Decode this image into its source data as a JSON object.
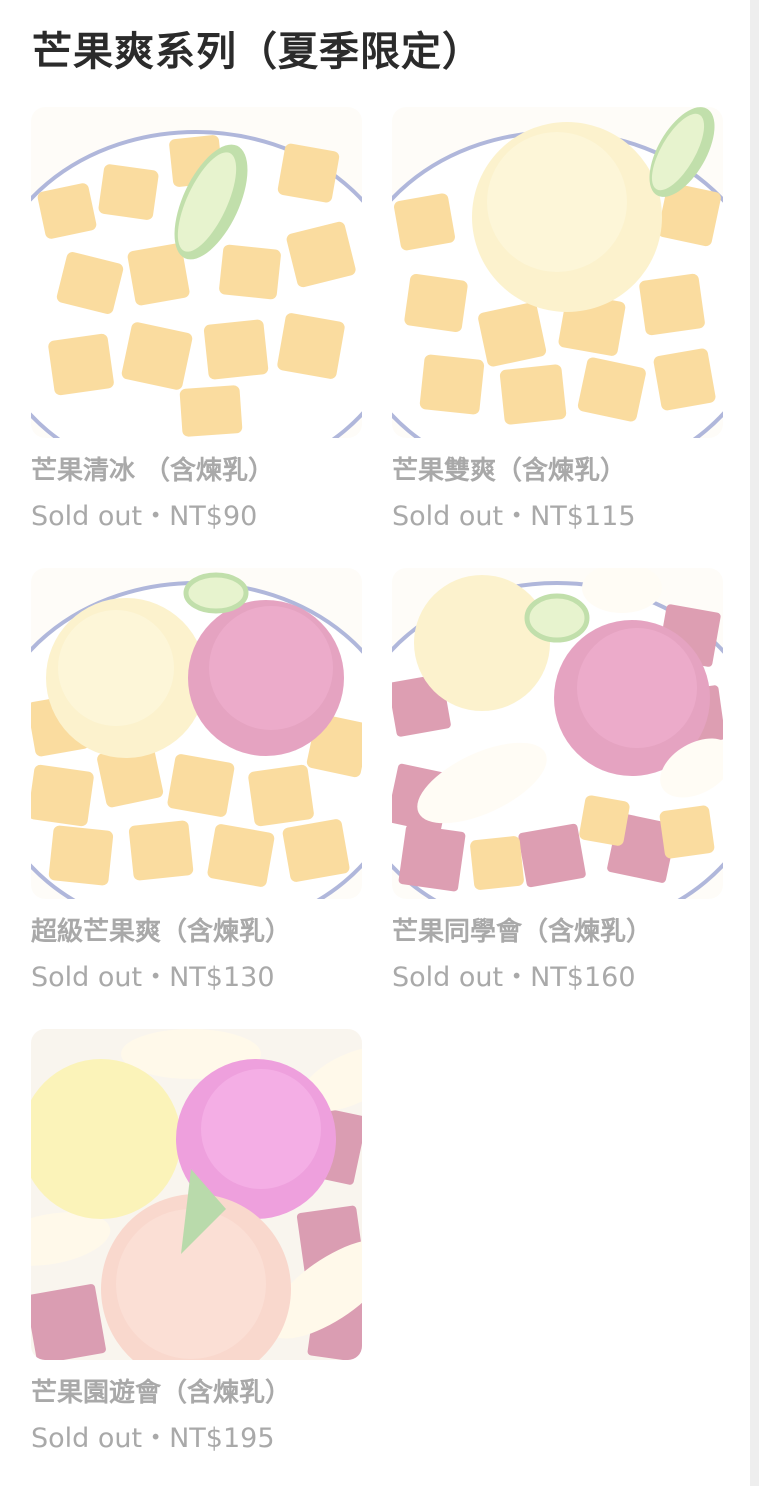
{
  "section": {
    "title": "芒果爽系列（夏季限定）"
  },
  "items": [
    {
      "name": "芒果清冰 （含煉乳）",
      "status": "Sold out",
      "separator": "・",
      "price": "NT$90"
    },
    {
      "name": "芒果雙爽（含煉乳）",
      "status": "Sold out",
      "separator": "・",
      "price": "NT$115"
    },
    {
      "name": "超級芒果爽（含煉乳）",
      "status": "Sold out",
      "separator": "・",
      "price": "NT$130"
    },
    {
      "name": "芒果同學會（含煉乳）",
      "status": "Sold out",
      "separator": "・",
      "price": "NT$160"
    },
    {
      "name": "芒果園遊會（含煉乳）",
      "status": "Sold out",
      "separator": "・",
      "price": "NT$195"
    }
  ],
  "colors": {
    "title": "#2b2b2b",
    "sold_out_text": "#a9a9a9",
    "mango": "#f7b733",
    "dragonfruit": "#c2266d",
    "lime": "#7cc142"
  }
}
